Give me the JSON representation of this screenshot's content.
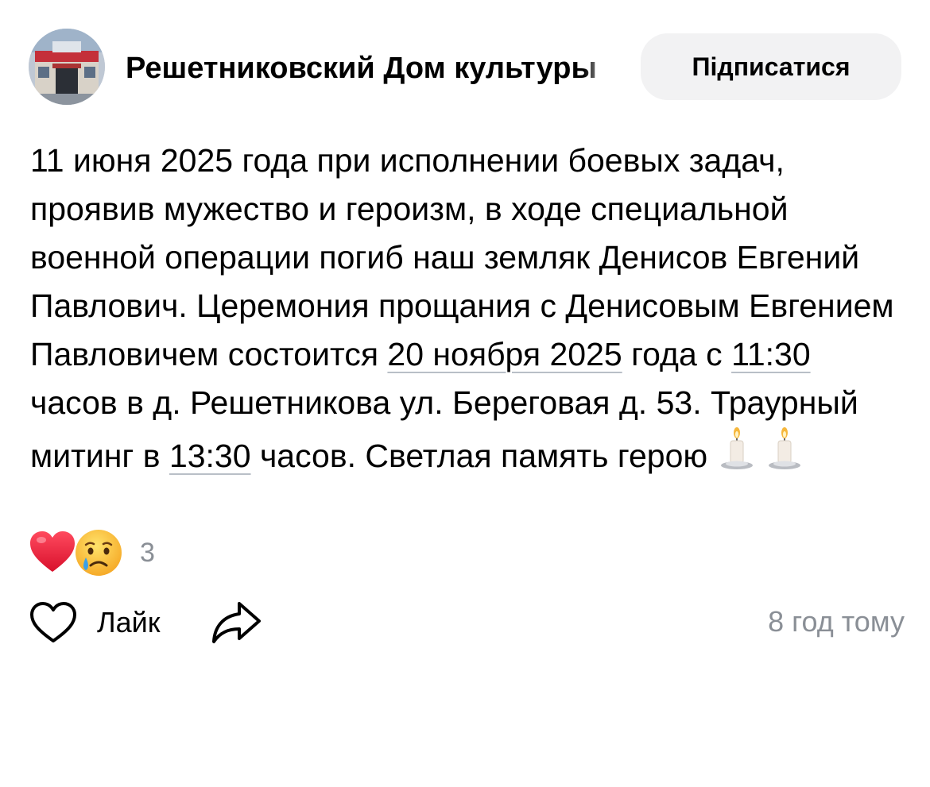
{
  "author": {
    "name": "Решетниковский Дом культуры",
    "avatar_icon": "building-photo-avatar"
  },
  "subscribe": {
    "label": "Підписатися"
  },
  "post": {
    "text_1": "11 июня 2025 года при исполнении боевых задач, проявив мужество и героизм, в ходе специальной военной операции погиб наш земляк Денисов Евгений Павлович. Церемония прощания с Денисовым Евгением Павловичем состоится ",
    "link_date": "20 ноября 2025",
    "text_2": " года с ",
    "link_time_1": "11:30",
    "text_3": " часов в д. Решетникова ул. Береговая д. 53. Траурный митинг в ",
    "link_time_2": "13:30",
    "text_4": " часов. Светлая память герою",
    "emoji_icons": [
      "candle-icon",
      "candle-icon"
    ]
  },
  "reactions": {
    "icons": [
      "red-heart-icon",
      "crying-face-icon"
    ],
    "count": "3"
  },
  "actions": {
    "like_label": "Лайк",
    "like_icon": "heart-outline-icon",
    "share_icon": "share-arrow-icon"
  },
  "meta": {
    "timestamp": "8 год тому"
  },
  "colors": {
    "text": "#000000",
    "muted": "#8a8f96",
    "button_bg": "#f2f2f3",
    "link_underline": "#b9bfc7",
    "heart_red": "#e8213d"
  }
}
